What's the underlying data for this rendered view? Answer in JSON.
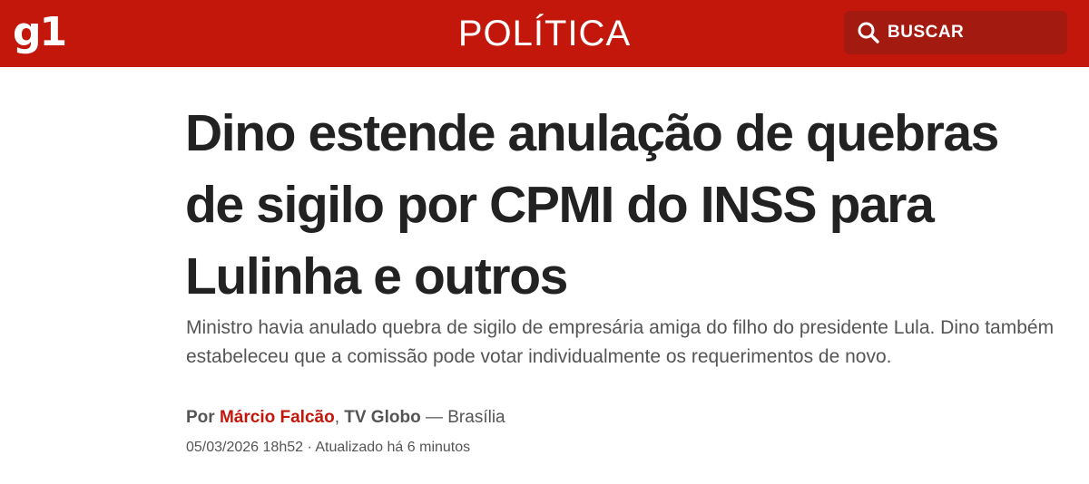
{
  "header": {
    "logo": "g1",
    "section": "POLÍTICA",
    "search_label": "BUSCAR",
    "search_icon": "search-icon",
    "brand_color": "#c4170c"
  },
  "article": {
    "headline": "Dino estende anulação de quebras de sigilo por CPMI do INSS para Lulinha e outros",
    "subtitle": "Ministro havia anulado quebra de sigilo de empresária amiga do filho do presidente Lula. Dino também estabeleceu que a comissão pode votar individualmente os requerimentos de novo.",
    "byline": {
      "prefix": "Por",
      "author": "Márcio Falcão",
      "separator": ",",
      "organization": "TV Globo",
      "dash": "—",
      "location": "Brasília"
    },
    "published": "05/03/2026 18h52",
    "dot": "·",
    "updated": "Atualizado há 6 minutos"
  }
}
